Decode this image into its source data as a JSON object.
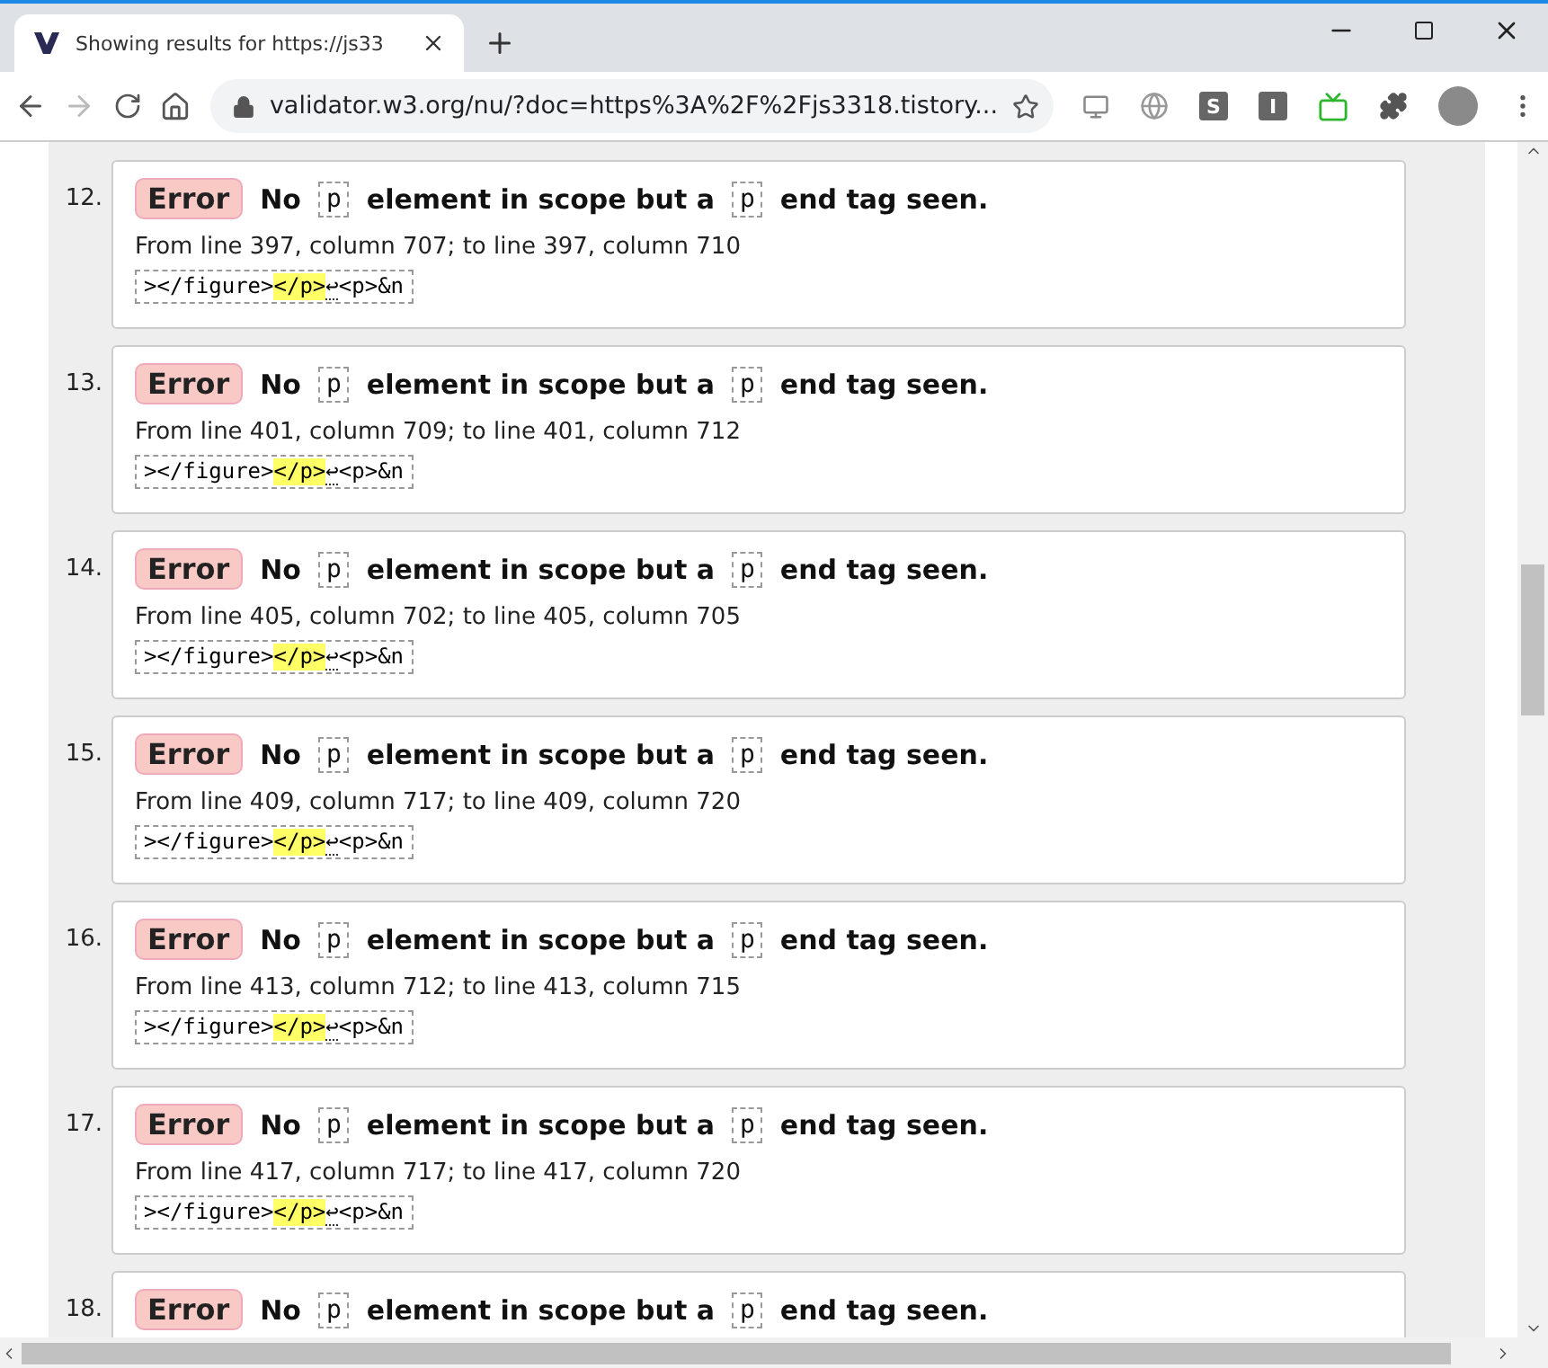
{
  "tab": {
    "title": "Showing results for https://js33",
    "selected": true
  },
  "address": {
    "url": "validator.w3.org/nu/?doc=https%3A%2F%2Fjs3318.tistory..."
  },
  "extensions": [
    {
      "kind": "screen"
    },
    {
      "kind": "globe"
    },
    {
      "kind": "letter",
      "label": "S"
    },
    {
      "kind": "letter",
      "label": "I"
    },
    {
      "kind": "tv"
    },
    {
      "kind": "puzzle"
    }
  ],
  "messages": [
    {
      "number": "12.",
      "type": "Error",
      "parts": [
        {
          "kind": "text",
          "text": "No"
        },
        {
          "kind": "code",
          "text": "p"
        },
        {
          "kind": "text",
          "text": "element in scope but a"
        },
        {
          "kind": "code",
          "text": "p"
        },
        {
          "kind": "text",
          "text": "end tag seen."
        }
      ],
      "location": "From line 397, column 707; to line 397, column 710",
      "extract": {
        "before": "></figure>",
        "highlight": "</p>",
        "newline": "↩",
        "after": "<p>&n"
      }
    },
    {
      "number": "13.",
      "type": "Error",
      "parts": [
        {
          "kind": "text",
          "text": "No"
        },
        {
          "kind": "code",
          "text": "p"
        },
        {
          "kind": "text",
          "text": "element in scope but a"
        },
        {
          "kind": "code",
          "text": "p"
        },
        {
          "kind": "text",
          "text": "end tag seen."
        }
      ],
      "location": "From line 401, column 709; to line 401, column 712",
      "extract": {
        "before": "></figure>",
        "highlight": "</p>",
        "newline": "↩",
        "after": "<p>&n"
      }
    },
    {
      "number": "14.",
      "type": "Error",
      "parts": [
        {
          "kind": "text",
          "text": "No"
        },
        {
          "kind": "code",
          "text": "p"
        },
        {
          "kind": "text",
          "text": "element in scope but a"
        },
        {
          "kind": "code",
          "text": "p"
        },
        {
          "kind": "text",
          "text": "end tag seen."
        }
      ],
      "location": "From line 405, column 702; to line 405, column 705",
      "extract": {
        "before": "></figure>",
        "highlight": "</p>",
        "newline": "↩",
        "after": "<p>&n"
      }
    },
    {
      "number": "15.",
      "type": "Error",
      "parts": [
        {
          "kind": "text",
          "text": "No"
        },
        {
          "kind": "code",
          "text": "p"
        },
        {
          "kind": "text",
          "text": "element in scope but a"
        },
        {
          "kind": "code",
          "text": "p"
        },
        {
          "kind": "text",
          "text": "end tag seen."
        }
      ],
      "location": "From line 409, column 717; to line 409, column 720",
      "extract": {
        "before": "></figure>",
        "highlight": "</p>",
        "newline": "↩",
        "after": "<p>&n"
      }
    },
    {
      "number": "16.",
      "type": "Error",
      "parts": [
        {
          "kind": "text",
          "text": "No"
        },
        {
          "kind": "code",
          "text": "p"
        },
        {
          "kind": "text",
          "text": "element in scope but a"
        },
        {
          "kind": "code",
          "text": "p"
        },
        {
          "kind": "text",
          "text": "end tag seen."
        }
      ],
      "location": "From line 413, column 712; to line 413, column 715",
      "extract": {
        "before": "></figure>",
        "highlight": "</p>",
        "newline": "↩",
        "after": "<p>&n"
      }
    },
    {
      "number": "17.",
      "type": "Error",
      "parts": [
        {
          "kind": "text",
          "text": "No"
        },
        {
          "kind": "code",
          "text": "p"
        },
        {
          "kind": "text",
          "text": "element in scope but a"
        },
        {
          "kind": "code",
          "text": "p"
        },
        {
          "kind": "text",
          "text": "end tag seen."
        }
      ],
      "location": "From line 417, column 717; to line 417, column 720",
      "extract": {
        "before": "></figure>",
        "highlight": "</p>",
        "newline": "↩",
        "after": "<p>&n"
      }
    },
    {
      "number": "18.",
      "type": "Error",
      "parts": [
        {
          "kind": "text",
          "text": "No"
        },
        {
          "kind": "code",
          "text": "p"
        },
        {
          "kind": "text",
          "text": "element in scope but a"
        },
        {
          "kind": "code",
          "text": "p"
        },
        {
          "kind": "text",
          "text": "end tag seen."
        }
      ]
    }
  ]
}
